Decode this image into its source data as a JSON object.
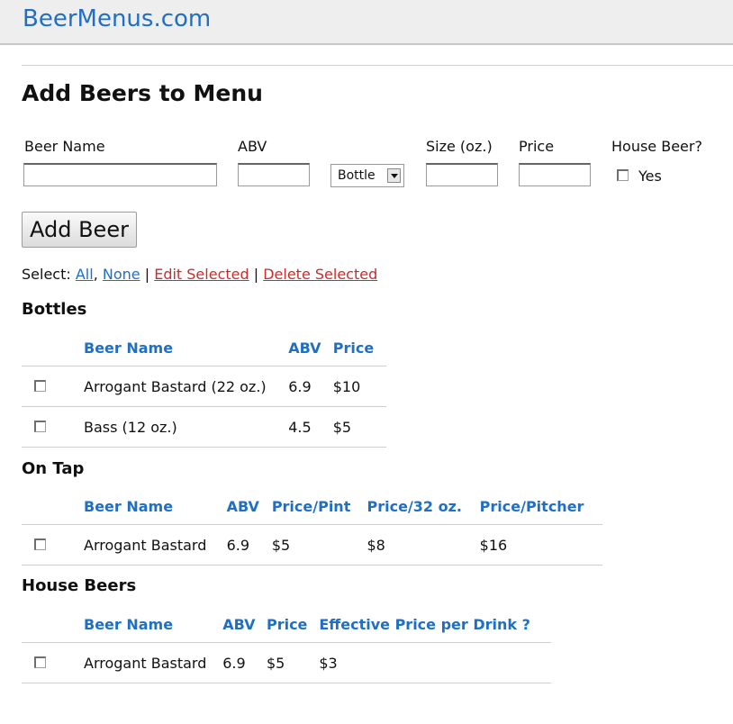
{
  "header": {
    "brand": "BeerMenus.com"
  },
  "page": {
    "title": "Add Beers to Menu"
  },
  "form": {
    "beer_name_label": "Beer Name",
    "beer_name_value": "",
    "abv_label": "ABV",
    "abv_value": "",
    "container_selected": "Bottle",
    "size_label": "Size (oz.)",
    "size_value": "",
    "price_label": "Price",
    "price_value": "",
    "house_beer_label": "House Beer?",
    "house_yes_label": "Yes",
    "add_button": "Add Beer"
  },
  "select_bar": {
    "label": "Select:",
    "all": "All",
    "comma": ",",
    "none": "None",
    "sep1": "|",
    "edit": "Edit Selected",
    "sep2": "|",
    "delete": "Delete Selected"
  },
  "bottles": {
    "title": "Bottles",
    "headers": [
      "Beer Name",
      "ABV",
      "Price"
    ],
    "rows": [
      [
        "Arrogant Bastard (22 oz.)",
        "6.9",
        "$10"
      ],
      [
        "Bass (12 oz.)",
        "4.5",
        "$5"
      ]
    ]
  },
  "on_tap": {
    "title": "On Tap",
    "headers": [
      "Beer Name",
      "ABV",
      "Price/Pint",
      "Price/32 oz.",
      "Price/Pitcher"
    ],
    "rows": [
      [
        "Arrogant Bastard",
        "6.9",
        "$5",
        "$8",
        "$16"
      ]
    ]
  },
  "house_beers": {
    "title": "House Beers",
    "headers": [
      "Beer Name",
      "ABV",
      "Price",
      "Effective Price per Drink ?"
    ],
    "rows": [
      [
        "Arrogant Bastard",
        "6.9",
        "$5",
        "$3"
      ]
    ]
  },
  "colors": {
    "link": "#1f6fc5",
    "danger_link": "#cc2b2b",
    "header_bg": "#eeeeee"
  }
}
